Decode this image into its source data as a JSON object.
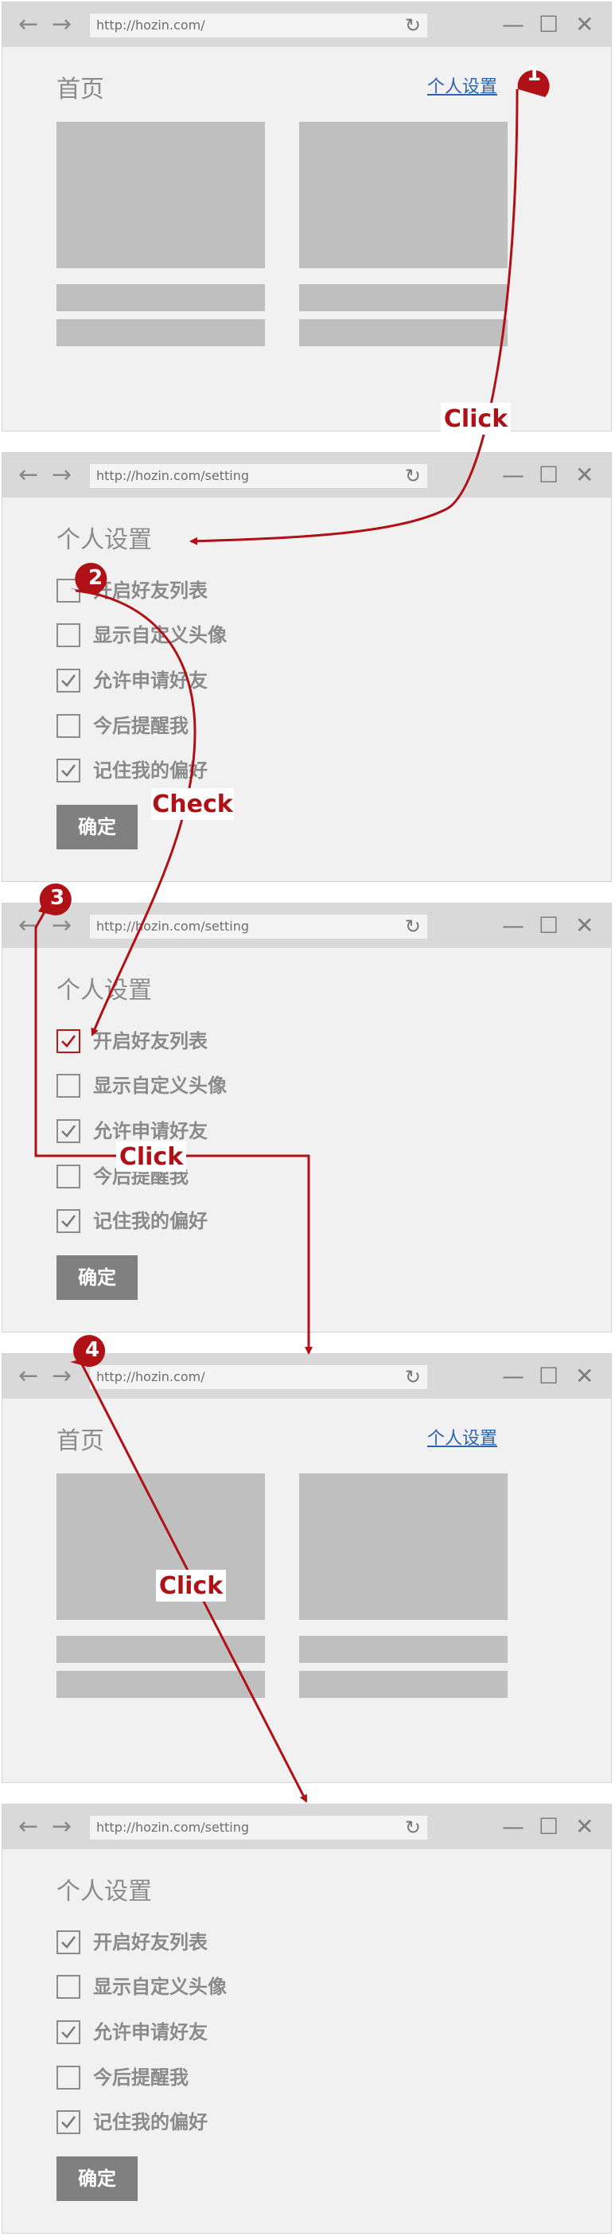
{
  "colors": {
    "accent": "#b01116",
    "link": "#2d63b5",
    "titlebar": "#d9d9d9",
    "window_bg": "#f1f1f1",
    "placeholder": "#bfbfbf"
  },
  "browser": {
    "back_icon": "←",
    "forward_icon": "→",
    "reload_icon": "↻",
    "minimize_icon": "—",
    "maximize_icon": "☐",
    "close_icon": "✕"
  },
  "windows": [
    {
      "kind": "home",
      "url": "http://hozin.com/",
      "title": "首页",
      "link": "个人设置"
    },
    {
      "kind": "settings",
      "url": "http://hozin.com/setting",
      "title": "个人设置",
      "options": [
        {
          "label": "开启好友列表",
          "checked": false,
          "highlight": false
        },
        {
          "label": "显示自定义头像",
          "checked": false,
          "highlight": false
        },
        {
          "label": "允许申请好友",
          "checked": true,
          "highlight": false
        },
        {
          "label": "今后提醒我",
          "checked": false,
          "highlight": false
        },
        {
          "label": "记住我的偏好",
          "checked": true,
          "highlight": false
        }
      ],
      "button": "确定"
    },
    {
      "kind": "settings",
      "url": "http://hozin.com/setting",
      "title": "个人设置",
      "options": [
        {
          "label": "开启好友列表",
          "checked": true,
          "highlight": true
        },
        {
          "label": "显示自定义头像",
          "checked": false,
          "highlight": false
        },
        {
          "label": "允许申请好友",
          "checked": true,
          "highlight": false
        },
        {
          "label": "今后提醒我",
          "checked": false,
          "highlight": false
        },
        {
          "label": "记住我的偏好",
          "checked": true,
          "highlight": false
        }
      ],
      "button": "确定"
    },
    {
      "kind": "home",
      "url": "http://hozin.com/",
      "title": "首页",
      "link": "个人设置"
    },
    {
      "kind": "settings",
      "url": "http://hozin.com/setting",
      "title": "个人设置",
      "options": [
        {
          "label": "开启好友列表",
          "checked": true,
          "highlight": false
        },
        {
          "label": "显示自定义头像",
          "checked": false,
          "highlight": false
        },
        {
          "label": "允许申请好友",
          "checked": true,
          "highlight": false
        },
        {
          "label": "今后提醒我",
          "checked": false,
          "highlight": false
        },
        {
          "label": "记住我的偏好",
          "checked": true,
          "highlight": false
        }
      ],
      "button": "确定"
    }
  ],
  "annotations": {
    "steps": [
      {
        "number": "1",
        "label": "Click"
      },
      {
        "number": "2",
        "label": "Check"
      },
      {
        "number": "3",
        "label": "Click"
      },
      {
        "number": "4",
        "label": "Click"
      }
    ]
  }
}
